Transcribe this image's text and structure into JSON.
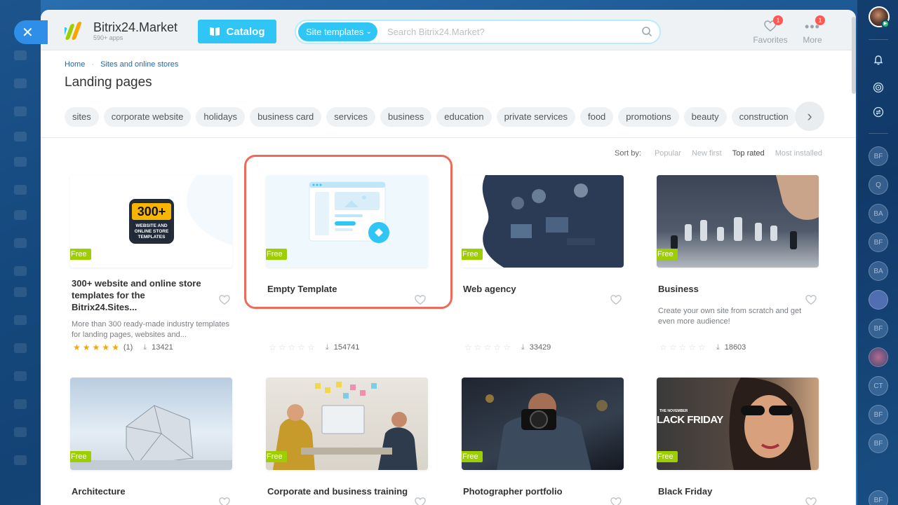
{
  "header": {
    "brand": "Bitrix24.Market",
    "brand_sub": "590+ apps",
    "catalog_label": "Catalog",
    "search_scope": "Site templates",
    "search_placeholder": "Search Bitrix24.Market?",
    "favorites_label": "Favorites",
    "favorites_badge": "1",
    "more_label": "More",
    "more_badge": "1"
  },
  "breadcrumb": {
    "home": "Home",
    "section": "Sites and online stores"
  },
  "page_title": "Landing pages",
  "chips": [
    "sites",
    "corporate website",
    "holidays",
    "business card",
    "services",
    "business",
    "education",
    "private services",
    "food",
    "promotions",
    "beauty",
    "construction"
  ],
  "sort": {
    "label": "Sort by:",
    "options": [
      "Popular",
      "New first",
      "Top rated",
      "Most installed"
    ],
    "active": "Top rated"
  },
  "badge_free": "Free",
  "cards": [
    {
      "title": "300+ website and online store templates for the Bitrix24.Sites...",
      "desc": "More than 300 ready-made industry templates for landing pages, websites and...",
      "rating": 5,
      "reviews": "(1)",
      "installs": "13421",
      "thumb_text": "300+",
      "thumb_sub": "WEBSITE AND ONLINE STORE TEMPLATES"
    },
    {
      "title": "Empty Template",
      "desc": "",
      "rating": 0,
      "reviews": "",
      "installs": "154741"
    },
    {
      "title": "Web agency",
      "desc": "",
      "rating": 0,
      "reviews": "",
      "installs": "33429"
    },
    {
      "title": "Business",
      "desc": "Create your own site from scratch and get even more audience!",
      "rating": 0,
      "reviews": "",
      "installs": "18603"
    },
    {
      "title": "Architecture"
    },
    {
      "title": "Corporate and business training"
    },
    {
      "title": "Photographer portfolio"
    },
    {
      "title": "Black Friday",
      "thumb_text": "LACK FRIDAY",
      "thumb_small": "THE NOVEMBER"
    }
  ],
  "right_bar": {
    "avatars": [
      "BF",
      "Q",
      "BA",
      "BF",
      "BA",
      "",
      "BF",
      "",
      "CT",
      "BF",
      "BF",
      "BF"
    ]
  },
  "colors": {
    "accent": "#2fc6f6",
    "free": "#9dcf00",
    "highlight": "#ee6a5a",
    "star": "#f7a700"
  },
  "icons": [
    "close-icon",
    "catalog-book-icon",
    "search-icon",
    "heart-icon",
    "more-dots-icon",
    "chevron-right-icon",
    "download-icon",
    "bell-icon",
    "star-icon"
  ]
}
